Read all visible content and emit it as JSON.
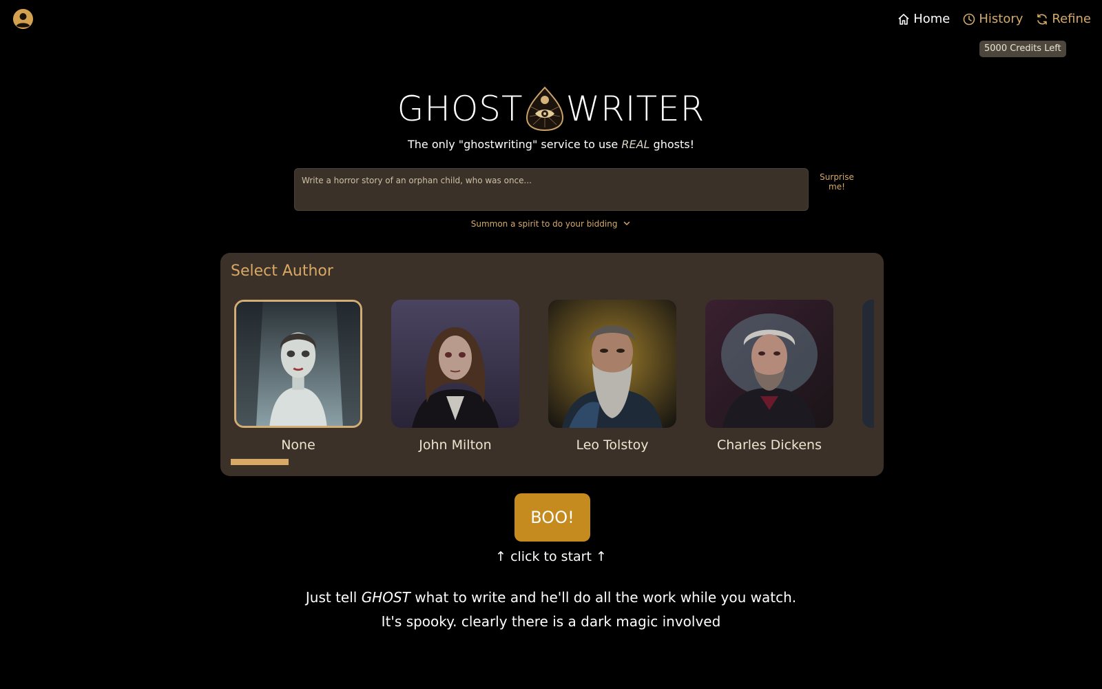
{
  "header": {
    "avatar_icon": "user-circle-icon",
    "nav": [
      {
        "label": "Home",
        "icon": "home-icon"
      },
      {
        "label": "History",
        "icon": "clock-icon"
      },
      {
        "label": "Refine",
        "icon": "refresh-icon"
      }
    ],
    "credits": "5000 Credits Left"
  },
  "logo": {
    "left": "GHOST",
    "right": "WRITER",
    "mark_icon": "planchette-eye-icon"
  },
  "tagline": {
    "before": "The only \"ghostwriting\" service to use ",
    "emphasis": "REAL",
    "after": " ghosts!"
  },
  "prompt": {
    "placeholder": "Write a horror story of an orphan child, who was once...",
    "value": ""
  },
  "surprise_label": "Surprise me!",
  "summon_label": "Summon a spirit to do your bidding",
  "author_panel": {
    "title": "Select Author",
    "selected": "None",
    "authors": [
      {
        "name": "None"
      },
      {
        "name": "John Milton"
      },
      {
        "name": "Leo Tolstoy"
      },
      {
        "name": "Charles Dickens"
      }
    ]
  },
  "start_button": "BOO!",
  "start_hint": "↑ click to start ↑",
  "description": {
    "line1_before": "Just tell ",
    "line1_emphasis": "GHOST",
    "line1_after": " what to write and he'll do all the work while you watch.",
    "line2": "It's spooky. clearly there is a dark magic involved"
  },
  "colors": {
    "accent": "#d4aa6a",
    "button": "#c58b1f",
    "panel": "#3b3128",
    "background": "#000000"
  }
}
